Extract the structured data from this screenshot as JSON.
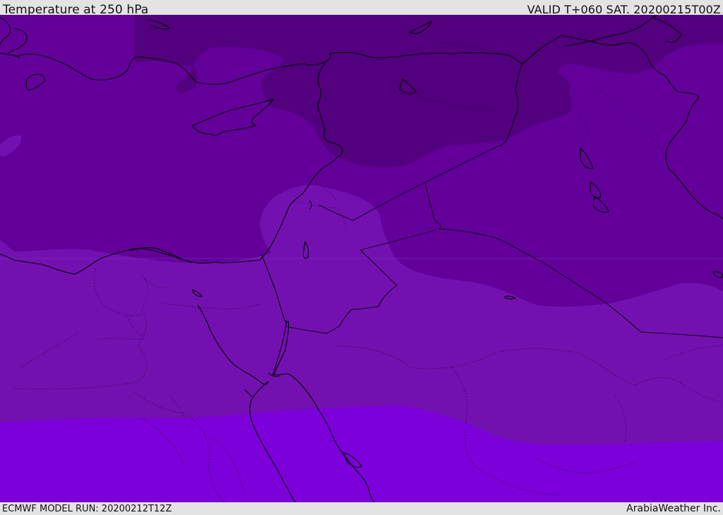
{
  "header": {
    "title": "Temperature at 250 hPa",
    "valid": "VALID T+060 SAT. 20200215T00Z"
  },
  "footer": {
    "model_run": "ECMWF MODEL RUN: 20200212T12Z",
    "credit": "ArabiaWeather Inc."
  },
  "colors": {
    "band_coldest": "#52007e",
    "band_cold": "#63009a",
    "band_mid": "#7311b0",
    "band_warm": "#7b00d9",
    "coastline": "#000000"
  }
}
